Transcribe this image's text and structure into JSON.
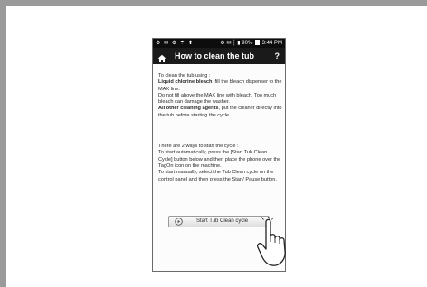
{
  "status_bar": {
    "left_icons": "⚙ ✉ ⚙ ☂ ⬆",
    "right_icons": "⚙ ✉ ┆ ▮",
    "battery_percent": "90%",
    "time": "3:44 PM"
  },
  "title_bar": {
    "title": "How to clean the tub",
    "help": "?"
  },
  "content": {
    "intro": "To clean the tub using :",
    "liquid_bold": "Liquid chlorine bleach",
    "liquid_text": ", fill the bleach dispenser to the MAX line.",
    "warning": "Do not fill above the MAX line with bleach. Too much bleach can damage the washer.",
    "other_bold": "All other cleaning agents",
    "other_text": ", put the cleaner directly into the tub before starting the cycle.",
    "ways_heading": "There are 2 ways to start the cycle :",
    "ways_auto": "To start automatically, press the [Start Tub Clean Cycle] button below and then place the phone over the TagOn icon on the machine.",
    "ways_manual": "To start manually, select the Tub Clean cycle on the control panel and then press the Start/ Pause button."
  },
  "start_button": {
    "label": "Start Tub Clean cycle"
  },
  "icons": {
    "home": "home-icon",
    "play": "play-icon",
    "hand": "pointing-hand-icon"
  }
}
